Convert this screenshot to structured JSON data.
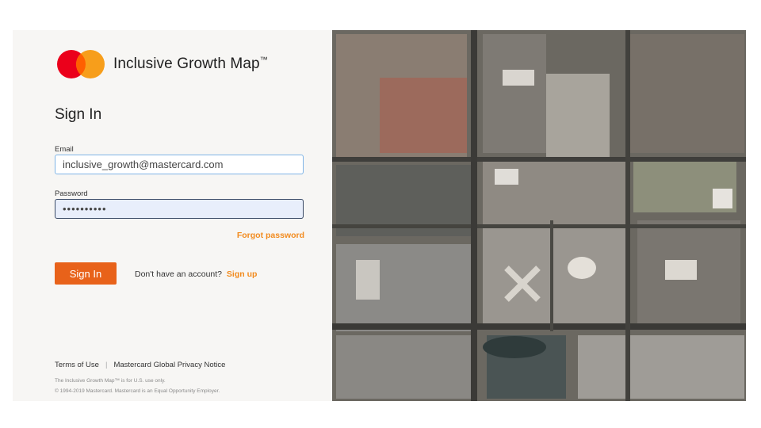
{
  "brand": {
    "name": "Inclusive Growth Map",
    "trademark": "™",
    "colors": {
      "red": "#eb001b",
      "yellow": "#f79e1b",
      "overlap": "#ff5f00"
    }
  },
  "signin": {
    "title": "Sign In",
    "email_label": "Email",
    "email_value": "inclusive_growth@mastercard.com",
    "password_label": "Password",
    "password_value": "••••••••••",
    "forgot_label": "Forgot password",
    "button_label": "Sign In",
    "no_account_text": "Don't have an account?",
    "signup_label": "Sign up"
  },
  "footer": {
    "terms_label": "Terms of Use",
    "separator": "|",
    "privacy_label": "Mastercard Global Privacy Notice",
    "notice": "The Inclusive Growth Map™ is for U.S. use only.",
    "copyright": "© 1994-2019 Mastercard. Mastercard is an Equal Opportunity Employer."
  },
  "theme": {
    "accent": "#e8621a",
    "link": "#f28b1e",
    "panel_bg": "#f7f6f4"
  }
}
